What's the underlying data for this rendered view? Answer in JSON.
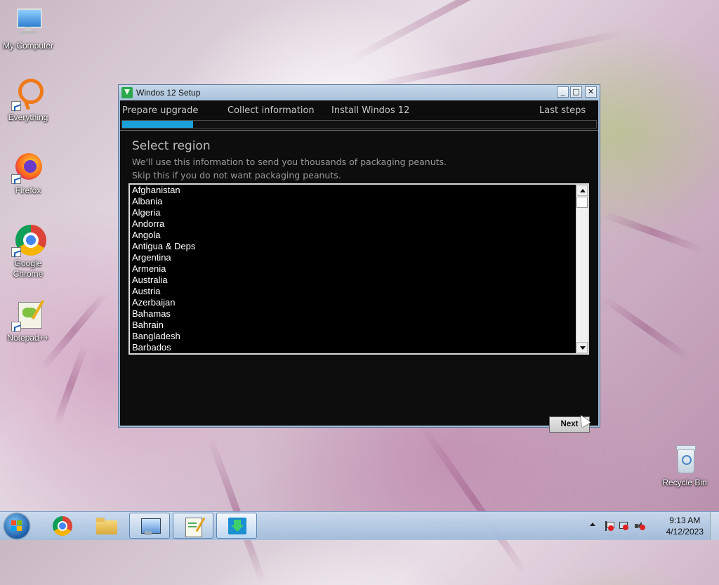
{
  "desktop": {
    "icons": [
      {
        "label": "My Computer"
      },
      {
        "label": "Everything"
      },
      {
        "label": "Firefox"
      },
      {
        "label": "Google Chrome"
      },
      {
        "label": "Notepad++"
      },
      {
        "label": "Recycle Bin"
      }
    ]
  },
  "window": {
    "title": "Windos 12 Setup",
    "controls": {
      "minimize": "_",
      "maximize": "□",
      "close": "✕"
    },
    "steps": [
      {
        "label": "Prepare upgrade"
      },
      {
        "label": "Collect information"
      },
      {
        "label": "Install Windos 12"
      },
      {
        "label": "Last steps"
      }
    ],
    "progress_fraction": 0.15,
    "heading": "Select region",
    "subtext_1": "We'll use this information to send you thousands of packaging peanuts.",
    "subtext_2": "Skip this if you do not want packaging peanuts.",
    "regions": [
      "Afghanistan",
      "Albania",
      "Algeria",
      "Andorra",
      "Angola",
      "Antigua & Deps",
      "Argentina",
      "Armenia",
      "Australia",
      "Austria",
      "Azerbaijan",
      "Bahamas",
      "Bahrain",
      "Bangladesh",
      "Barbados"
    ],
    "next_label": "Next"
  },
  "taskbar": {
    "items": [
      {
        "name": "chrome-taskbar-item"
      },
      {
        "name": "explorer-taskbar-item"
      },
      {
        "name": "control-panel-taskbar-item"
      },
      {
        "name": "notepad-taskbar-item"
      },
      {
        "name": "setup-taskbar-item"
      }
    ],
    "time": "9:13 AM",
    "date": "4/12/2023"
  },
  "colors": {
    "accent": "#1b9fd8",
    "window_bg": "#0d0d0d"
  }
}
